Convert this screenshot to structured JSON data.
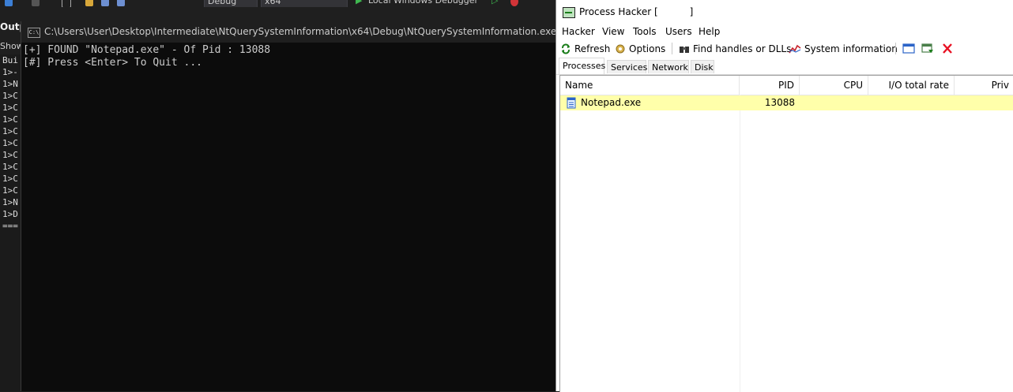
{
  "vs": {
    "toolbar": {
      "config": "Debug",
      "platform": "x64",
      "debugger": "Local Windows Debugger"
    },
    "output": {
      "title": "Outpu",
      "show": "Show",
      "lines": [
        "Bui",
        "1>-",
        "1>N",
        "1>C",
        "1>C",
        "1>C",
        "1>C",
        "1>C",
        "1>C",
        "1>C",
        "1>C",
        "1>C",
        "1>N",
        "1>D",
        "==="
      ]
    }
  },
  "console": {
    "icon_text": "C:\\",
    "title": "C:\\Users\\User\\Desktop\\Intermediate\\NtQuerySystemInformation\\x64\\Debug\\NtQuerySystemInformation.exe",
    "lines": [
      "[+] FOUND \"Notepad.exe\" - Of Pid : 13088",
      "[#] Press <Enter> To Quit ..."
    ]
  },
  "process_hacker": {
    "title": "Process Hacker [",
    "title_close": "]",
    "menu": [
      "Hacker",
      "View",
      "Tools",
      "Users",
      "Help"
    ],
    "toolbar": {
      "refresh": "Refresh",
      "options": "Options",
      "find": "Find handles or DLLs",
      "sysinfo": "System information"
    },
    "tabs": [
      "Processes",
      "Services",
      "Network",
      "Disk"
    ],
    "columns": {
      "name": "Name",
      "pid": "PID",
      "cpu": "CPU",
      "io": "I/O total rate",
      "priv": "Priv"
    },
    "rows": [
      {
        "name": "Notepad.exe",
        "pid": "13088",
        "cpu": "",
        "io": ""
      }
    ],
    "colors": {
      "highlight": "#ffffaa",
      "accent_green": "#1a7d1a",
      "close_red": "#e81123"
    }
  }
}
